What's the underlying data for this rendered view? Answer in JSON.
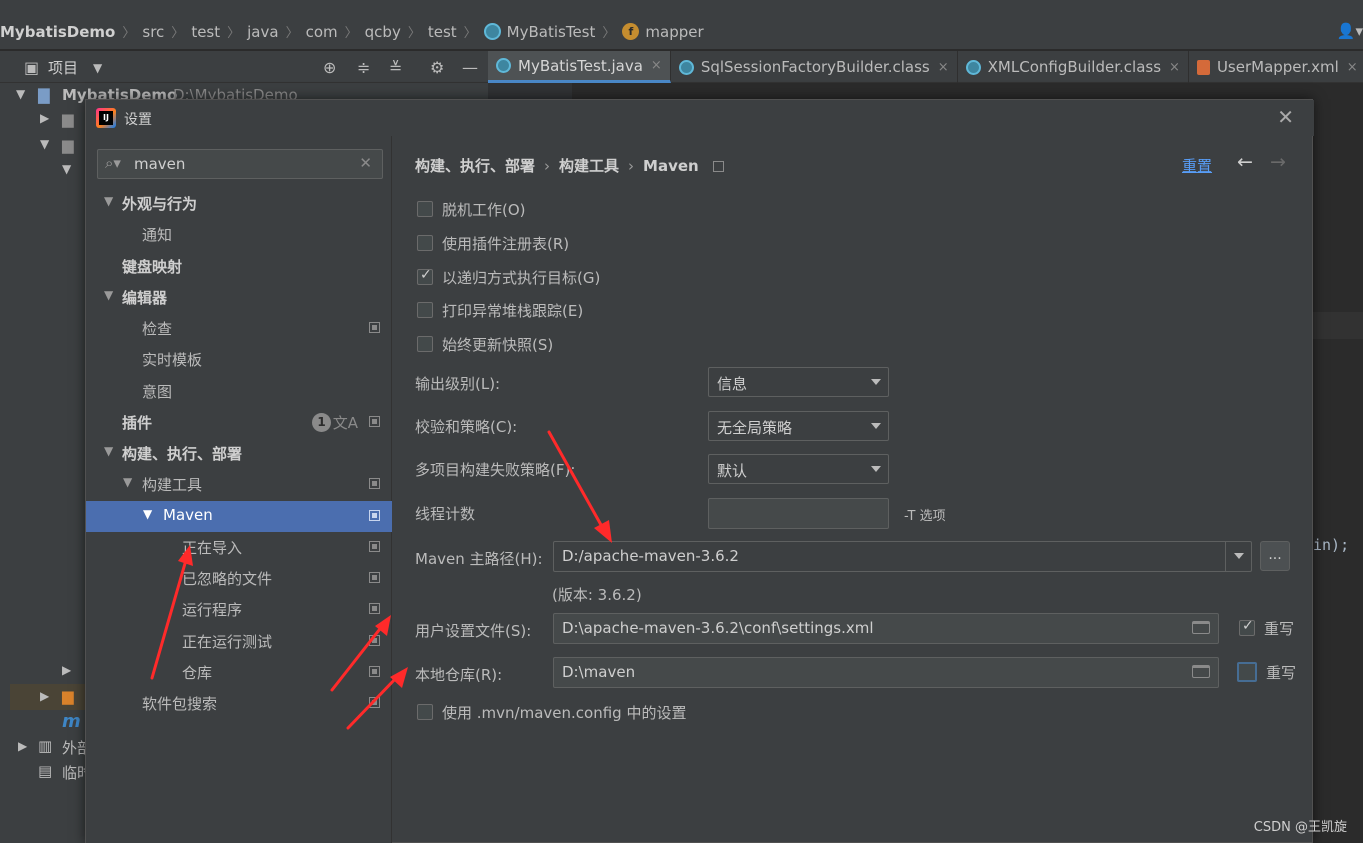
{
  "navbar": {
    "crumbs": [
      "MybatisDemo",
      "src",
      "test",
      "java",
      "com",
      "qcby",
      "test",
      "MyBatisTest",
      "mapper"
    ],
    "icons": {
      "class": "class-c-icon",
      "field": "field-f-icon"
    }
  },
  "project": {
    "title": "项目",
    "root_label": "MybatisDemo",
    "root_path": "D:\\MybatisDemo",
    "partial_items": [
      "外部",
      "临时"
    ]
  },
  "tabs": [
    {
      "label": "MyBatisTest.java",
      "active": true
    },
    {
      "label": "SqlSessionFactoryBuilder.class",
      "active": false
    },
    {
      "label": "XMLConfigBuilder.class",
      "active": false
    },
    {
      "label": "UserMapper.xml",
      "active": false
    }
  ],
  "editor": {
    "partial_code": "in);"
  },
  "dialog": {
    "title": "设置",
    "search_value": "maven",
    "tree": [
      {
        "label": "外观与行为",
        "level": 0,
        "bold": true,
        "expanded": true
      },
      {
        "label": "通知",
        "level": 1
      },
      {
        "label": "键盘映射",
        "level": 0,
        "bold": true
      },
      {
        "label": "编辑器",
        "level": 0,
        "bold": true,
        "expanded": true
      },
      {
        "label": "检查",
        "level": 1,
        "page_icon": true
      },
      {
        "label": "实时模板",
        "level": 1
      },
      {
        "label": "意图",
        "level": 1
      },
      {
        "label": "插件",
        "level": 0,
        "bold": true,
        "badge": "1",
        "page_icon": true
      },
      {
        "label": "构建、执行、部署",
        "level": 0,
        "bold": true,
        "expanded": true
      },
      {
        "label": "构建工具",
        "level": 1,
        "expanded": true,
        "page_icon": true
      },
      {
        "label": "Maven",
        "level": 2,
        "expanded": true,
        "selected": true,
        "page_icon": true
      },
      {
        "label": "正在导入",
        "level": 3,
        "page_icon": true
      },
      {
        "label": "已忽略的文件",
        "level": 3,
        "page_icon": true
      },
      {
        "label": "运行程序",
        "level": 3,
        "page_icon": true
      },
      {
        "label": "正在运行测试",
        "level": 3,
        "page_icon": true
      },
      {
        "label": "仓库",
        "level": 3,
        "page_icon": true
      },
      {
        "label": "软件包搜索",
        "level": 1,
        "page_icon": true
      }
    ],
    "breadcrumb": [
      "构建、执行、部署",
      "构建工具",
      "Maven"
    ],
    "reset_label": "重置",
    "checkboxes": [
      {
        "label": "脱机工作(O)",
        "checked": false
      },
      {
        "label": "使用插件注册表(R)",
        "checked": false
      },
      {
        "label": "以递归方式执行目标(G)",
        "checked": true
      },
      {
        "label": "打印异常堆栈跟踪(E)",
        "checked": false
      },
      {
        "label": "始终更新快照(S)",
        "checked": false
      }
    ],
    "output_level": {
      "label": "输出级别(L):",
      "value": "信息"
    },
    "checksum_policy": {
      "label": "校验和策略(C):",
      "value": "无全局策略"
    },
    "fail_policy": {
      "label": "多项目构建失败策略(F):",
      "value": "默认"
    },
    "thread_count": {
      "label": "线程计数",
      "value": "",
      "suffix": "-T 选项"
    },
    "maven_home": {
      "label": "Maven 主路径(H):",
      "value": "D:/apache-maven-3.6.2",
      "version": "(版本: 3.6.2)",
      "browse_label": "..."
    },
    "user_settings": {
      "label": "用户设置文件(S):",
      "value": "D:\\apache-maven-3.6.2\\conf\\settings.xml",
      "override_label": "重写",
      "override_checked": true
    },
    "local_repo": {
      "label": "本地仓库(R):",
      "value": "D:\\maven",
      "override_label": "重写",
      "override_checked": false
    },
    "mvn_config": {
      "label": "使用 .mvn/maven.config 中的设置",
      "checked": false
    }
  },
  "watermark": "CSDN @王凯旋",
  "colors": {
    "selection": "#4b6eaf",
    "link": "#589df6",
    "annotation_arrow": "#ff2a2a"
  }
}
